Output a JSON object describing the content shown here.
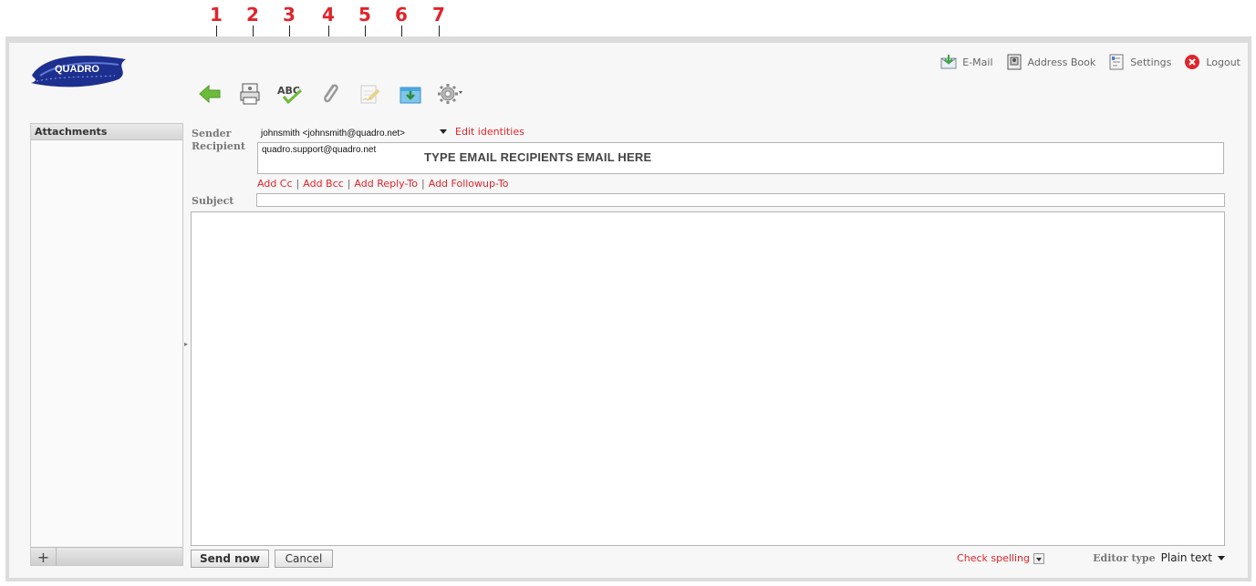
{
  "callouts": [
    "1",
    "2",
    "3",
    "4",
    "5",
    "6",
    "7"
  ],
  "logo_text": "QUADRO",
  "topnav": {
    "email_label": "E-Mail",
    "addressbook_label": "Address Book",
    "settings_label": "Settings",
    "logout_label": "Logout"
  },
  "toolbar": {
    "icons": [
      "back-arrow-icon",
      "print-icon",
      "spellcheck-icon",
      "paperclip-icon",
      "signature-icon",
      "save-draft-icon",
      "gear-icon"
    ]
  },
  "sidebar": {
    "header": "Attachments",
    "add_label": "+"
  },
  "form": {
    "sender_label": "Sender",
    "sender_value": "johnsmith  <johnsmith@quadro.net>",
    "edit_identities": "Edit identities",
    "recipient_label": "Recipient",
    "recipient_value": "quadro.support@quadro.net",
    "recipient_hint": "TYPE EMAIL RECIPIENTS EMAIL HERE",
    "add_cc": "Add Cc",
    "add_bcc": "Add Bcc",
    "add_replyto": "Add Reply-To",
    "add_followupto": "Add Followup-To",
    "separator": "|",
    "subject_label": "Subject",
    "subject_value": ""
  },
  "bottom": {
    "send_label": "Send now",
    "cancel_label": "Cancel",
    "check_spelling": "Check spelling",
    "editor_type_label": "Editor type",
    "editor_type_value": "Plain text"
  },
  "colors": {
    "accent_red": "#e0242b",
    "background": "#f7f7f7",
    "frame": "#dcdcdc"
  }
}
